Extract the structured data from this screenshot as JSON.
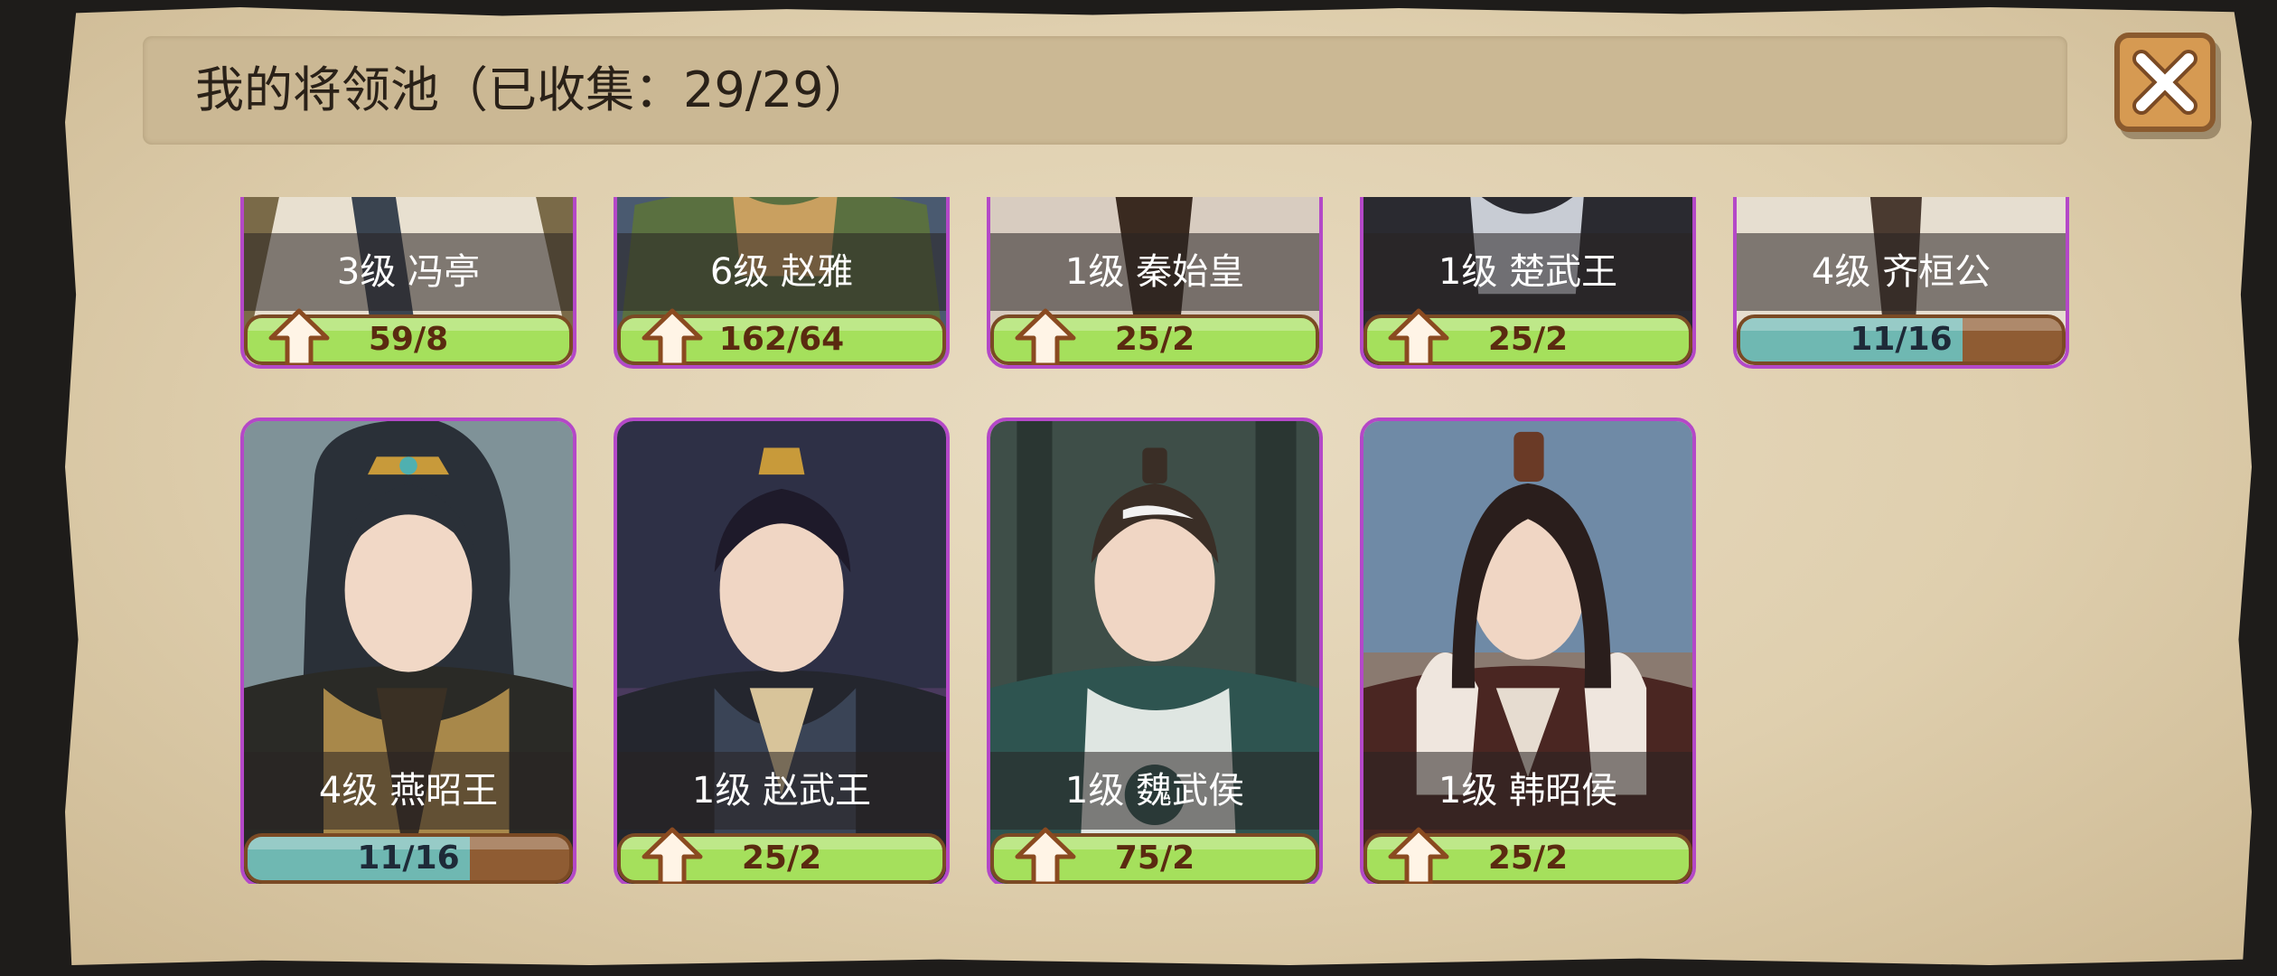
{
  "header": {
    "title": "我的将领池（已收集：29/29）"
  },
  "close_button": {
    "icon": "close-icon"
  },
  "colors": {
    "card_border": "#b448c8",
    "bar_green": "#a5e05c",
    "bar_teal": "#6fb8b2",
    "bar_brown": "#8f5c33"
  },
  "generals": [
    {
      "label": "3级   冯亭",
      "count": "59/8",
      "upgradable": true
    },
    {
      "label": "6级   赵雅",
      "count": "162/64",
      "upgradable": true
    },
    {
      "label": "1级 秦始皇",
      "count": "25/2",
      "upgradable": true
    },
    {
      "label": "1级 楚武王",
      "count": "25/2",
      "upgradable": true
    },
    {
      "label": "4级 齐桓公",
      "count": "11/16",
      "upgradable": false,
      "progress": 0.69
    },
    {
      "label": "4级 燕昭王",
      "count": "11/16",
      "upgradable": false,
      "progress": 0.69
    },
    {
      "label": "1级 赵武王",
      "count": "25/2",
      "upgradable": true
    },
    {
      "label": "1级 魏武侯",
      "count": "75/2",
      "upgradable": true
    },
    {
      "label": "1级 韩昭侯",
      "count": "25/2",
      "upgradable": true
    }
  ]
}
